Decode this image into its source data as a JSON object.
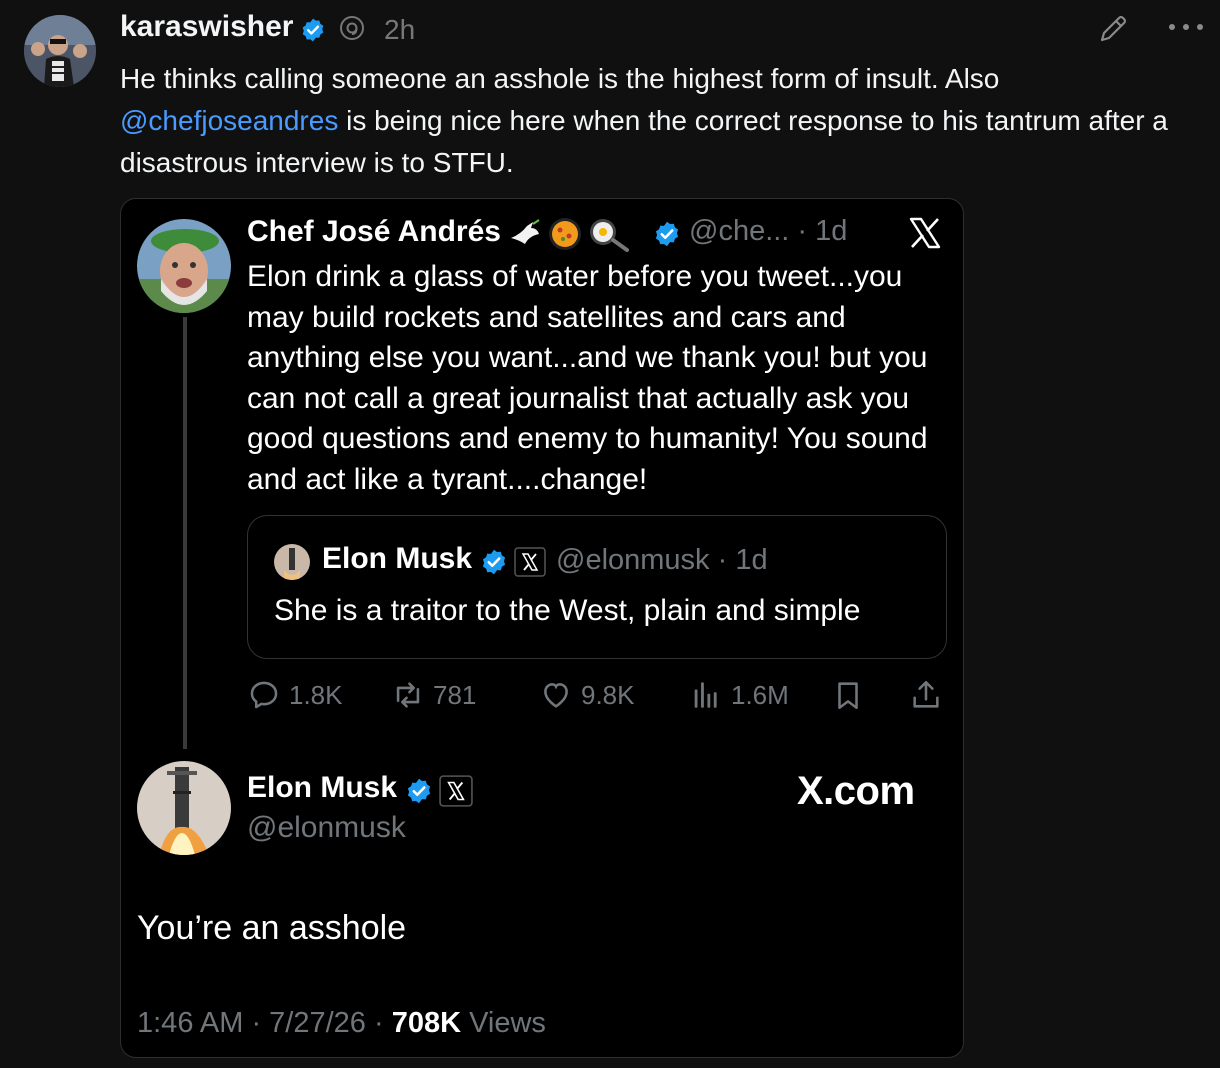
{
  "post": {
    "username": "karaswisher",
    "time": "2h",
    "text_part1": "He thinks calling someone an asshole is the highest form of insult. Also ",
    "mention": "@chefjoseandres",
    "text_part2": " is being nice here when the correct response to his tantrum after a disastrous interview is to STFU.",
    "icons": [
      "avatar",
      "verified-badge-icon",
      "threads-icon",
      "edit-icon",
      "more-icon"
    ]
  },
  "embed": {
    "jose": {
      "name": "Chef José Andrés",
      "meta": "@che... · 1d",
      "text": "Elon drink a glass of water before you tweet...you may build rockets and satellites and cars and anything else you want...and we thank you! but you can not call a great journalist that actually ask you good questions and enemy to humanity! You sound and act like a tyrant....change!",
      "emojis": [
        "dove-emoji",
        "paella-emoji",
        "frying-pan-emoji"
      ]
    },
    "quote": {
      "name": "Elon Musk",
      "meta": "@elonmusk · 1d",
      "text": "She is a traitor to the West, plain and simple"
    },
    "actions": {
      "replies": "1.8K",
      "reposts": "781",
      "likes": "9.8K",
      "views": "1.6M"
    },
    "reply": {
      "name": "Elon Musk",
      "handle": "@elonmusk",
      "text": "You’re an asshole",
      "time_date": "1:46 AM · 7/27/26 · ",
      "views_count": "708K",
      "views_label": " Views"
    },
    "watermark": "X.com"
  },
  "colors": {
    "background": "#101010",
    "card_background": "#000000",
    "link": "#4a9bff",
    "verified": "#1d9bf0",
    "muted": "#71767b"
  }
}
